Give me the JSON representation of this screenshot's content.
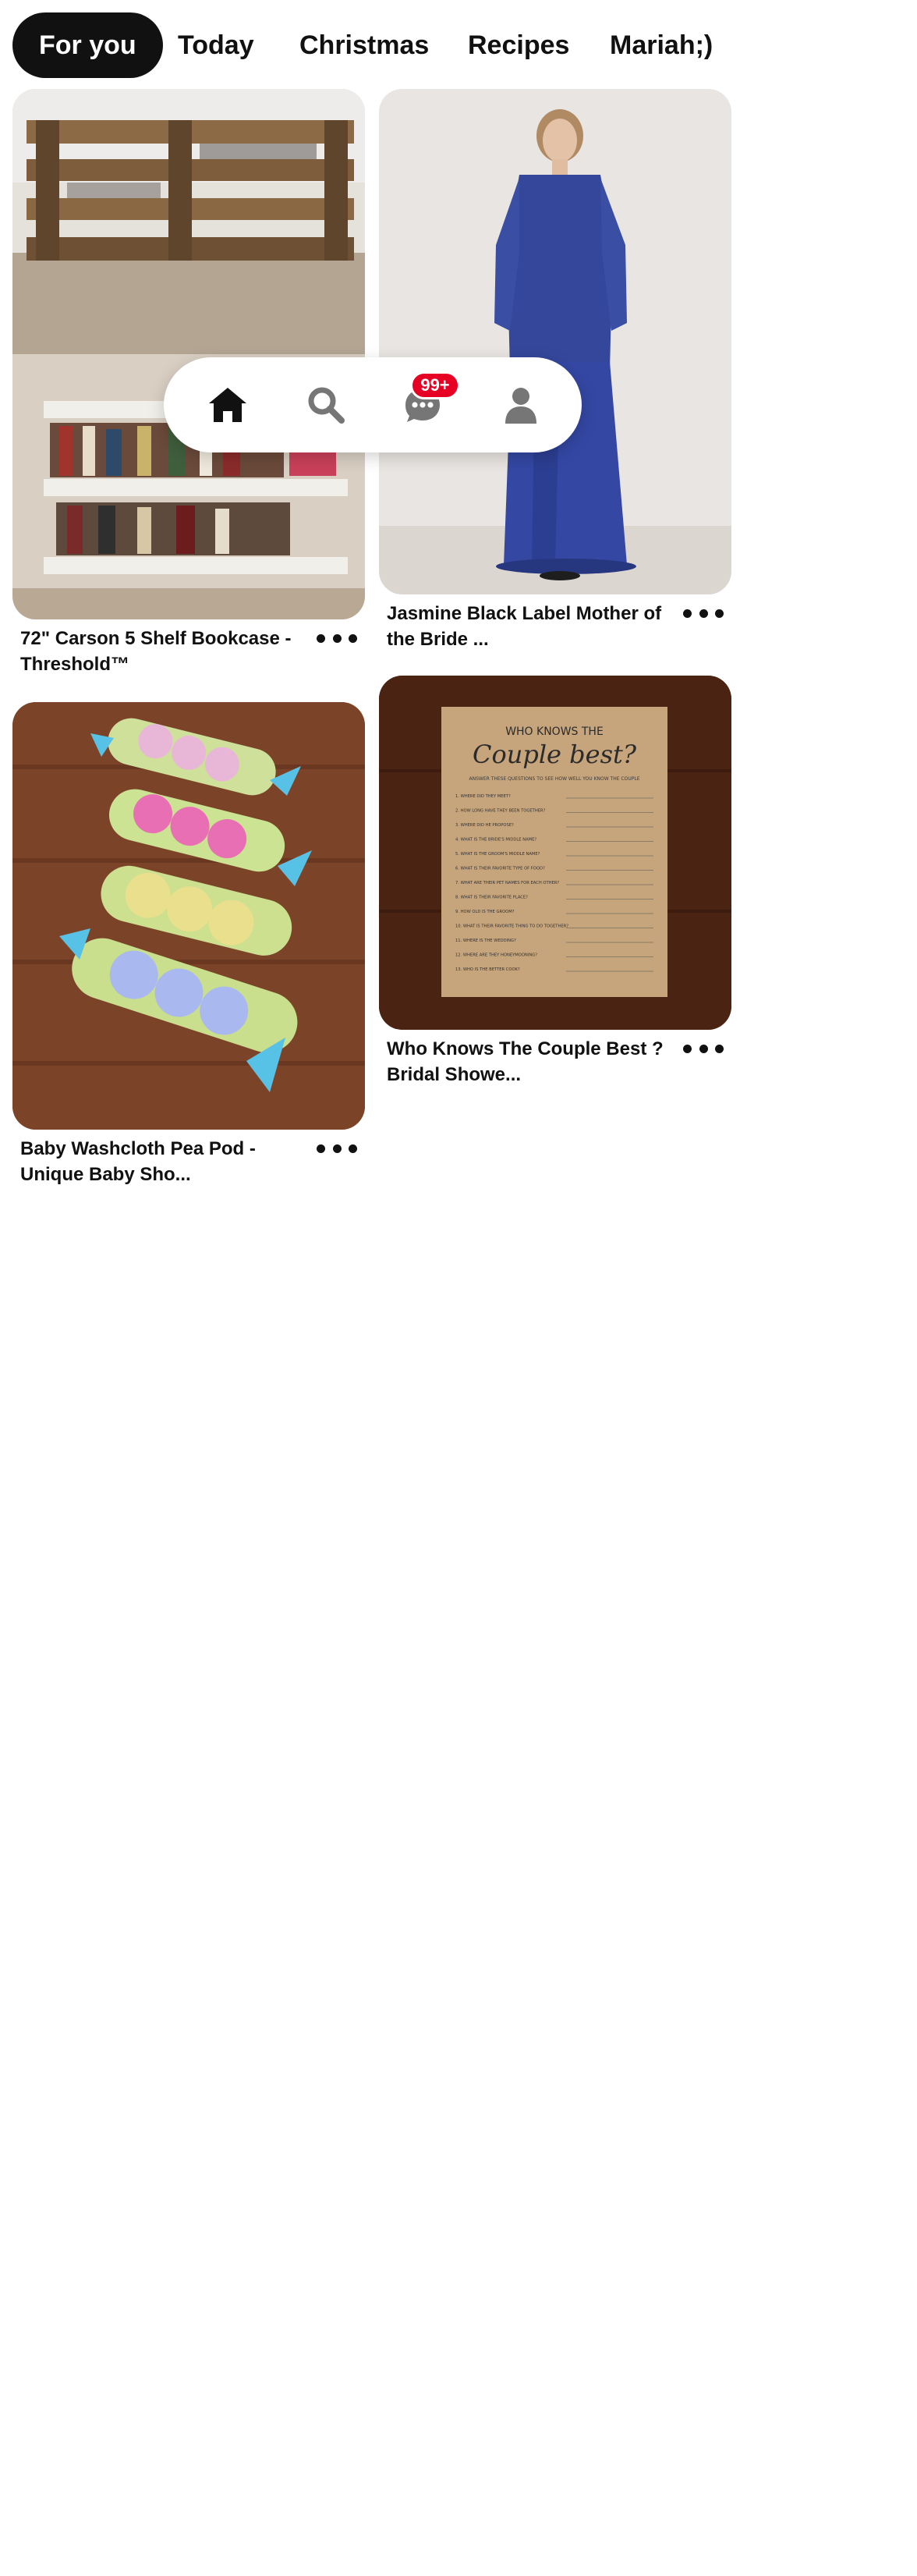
{
  "tabs": [
    "For you",
    "Today",
    "Christmas",
    "Recipes",
    "Mariah;)"
  ],
  "active_tab": "For you",
  "pins": [
    {
      "title": "72\" Carson 5 Shelf Bookcase - Threshold™",
      "image": "pallet-bookcase-photo"
    },
    {
      "title": "Jasmine Black Label Mother of the Bride ...",
      "image": "blue-lace-gown-photo"
    },
    {
      "title": "Baby Washcloth Pea Pod - Unique Baby Sho...",
      "image": "washcloth-pea-pods-photo"
    },
    {
      "title": "Who Knows The Couple Best ? Bridal Showe...",
      "image": "couple-quiz-card-photo"
    }
  ],
  "quiz_card": {
    "heading_top": "WHO KNOWS THE",
    "heading_main": "Couple best?",
    "instructions": "ANSWER THESE QUESTIONS TO SEE HOW WELL YOU KNOW THE COUPLE",
    "questions": [
      "1. WHERE DID THEY MEET?",
      "2. HOW LONG HAVE THEY BEEN TOGETHER?",
      "3. WHERE DID HE PROPOSE?",
      "4. WHAT IS THE BRIDE'S MIDDLE NAME?",
      "5. WHAT IS THE GROOM'S MIDDLE NAME?",
      "6. WHAT IS THEIR FAVORITE TYPE OF FOOD?",
      "7. WHAT ARE THEIR PET NAMES FOR EACH OTHER?",
      "8. WHAT IS THEIR FAVORITE PLACE?",
      "9. HOW OLD IS THE GROOM?",
      "10. WHAT IS THEIR FAVORITE THING TO DO TOGETHER?",
      "11. WHERE IS THE WEDDING?",
      "12. WHERE ARE THEY HONEYMOONING?",
      "13. WHO IS THE BETTER COOK?"
    ]
  },
  "nav": {
    "items": [
      "home-icon",
      "search-icon",
      "messages-icon",
      "profile-icon"
    ],
    "active": "home-icon",
    "messages_badge": "99+"
  },
  "colors": {
    "accent": "#e60023",
    "active_tab_bg": "#111111",
    "icon_inactive": "#767676"
  }
}
